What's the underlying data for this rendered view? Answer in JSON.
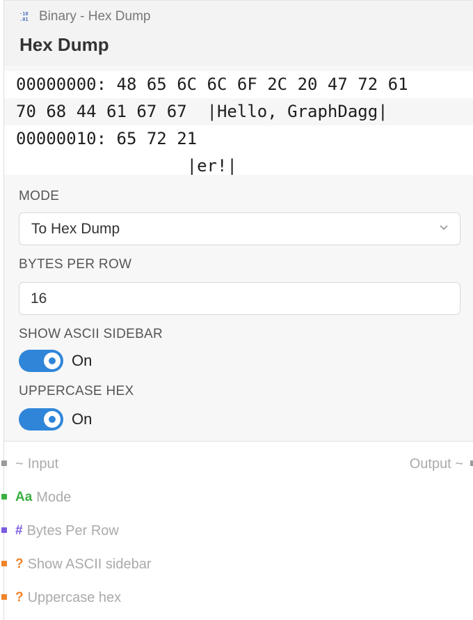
{
  "node": {
    "category": "Binary - Hex Dump",
    "category_icon": "binary-icon",
    "title": "Hex Dump"
  },
  "dump": {
    "lines": [
      "00000000: 48 65 6C 6C 6F 2C 20 47 72 61",
      "70 68 44 61 67 67  |Hello, GraphDagg|",
      "00000010: 65 72 21",
      "                 |er!|"
    ]
  },
  "params": {
    "mode_label": "MODE",
    "mode_value": "To Hex Dump",
    "bytes_label": "BYTES PER ROW",
    "bytes_value": "16",
    "ascii_label": "SHOW ASCII SIDEBAR",
    "ascii_state": "On",
    "upper_label": "UPPERCASE HEX",
    "upper_state": "On"
  },
  "ports": {
    "input": {
      "symbol": "~",
      "label": "Input"
    },
    "output": {
      "symbol": "~",
      "label": "Output"
    },
    "items": [
      {
        "symbol": "Aa",
        "label": "Mode",
        "color": "#3cb043"
      },
      {
        "symbol": "#",
        "label": "Bytes Per Row",
        "color": "#7a5ce0"
      },
      {
        "symbol": "?",
        "label": "Show ASCII sidebar",
        "color": "#f0832a"
      },
      {
        "symbol": "?",
        "label": "Uppercase hex",
        "color": "#f0832a"
      }
    ]
  },
  "colors": {
    "accent": "#2f86d9",
    "port_neutral": "#9a9a9a"
  }
}
